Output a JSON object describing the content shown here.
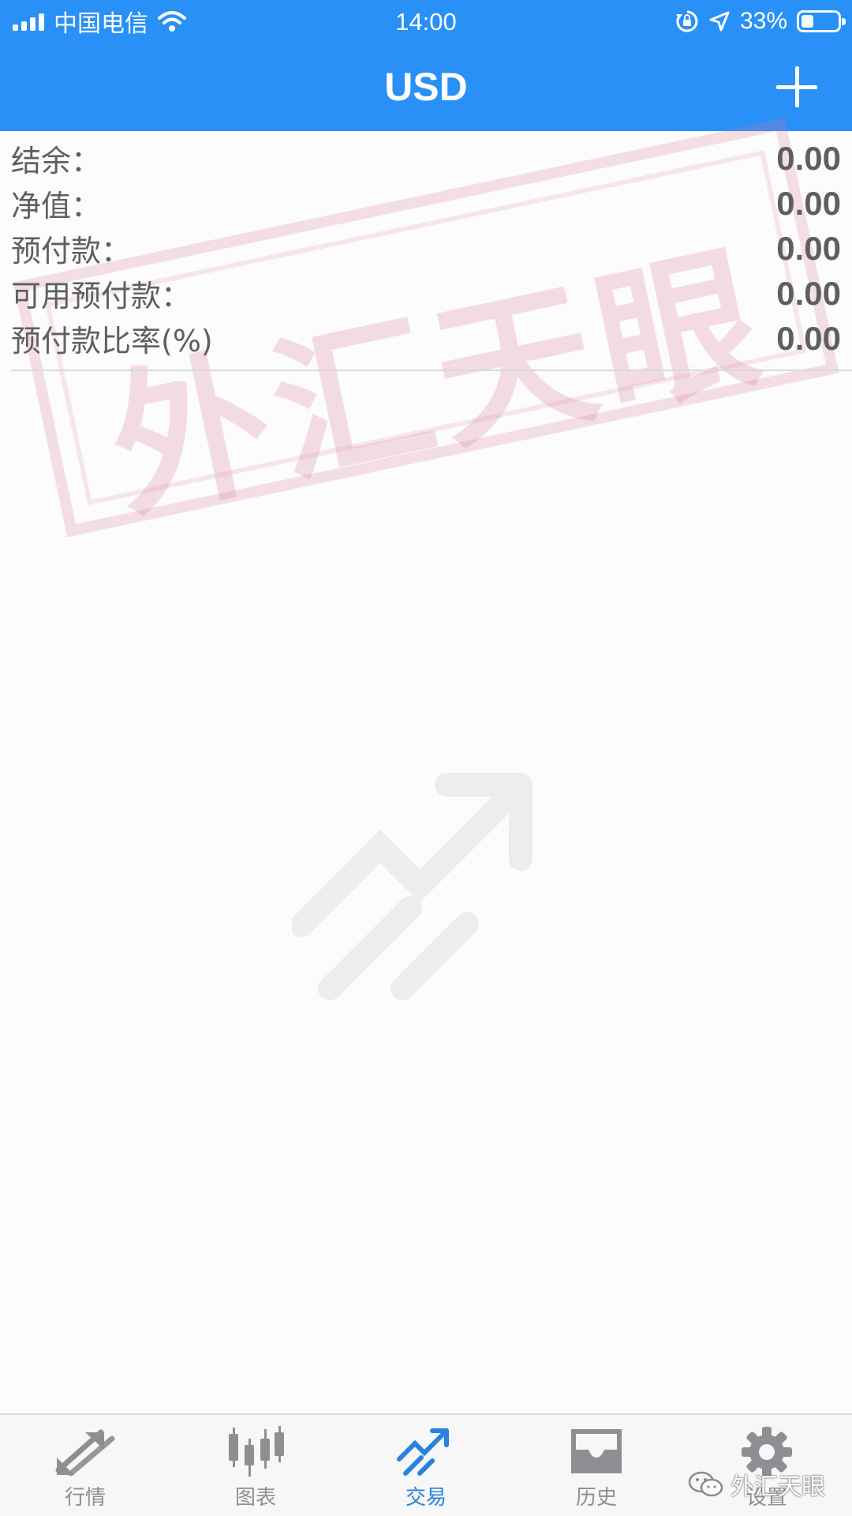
{
  "status_bar": {
    "carrier": "中国电信",
    "time": "14:00",
    "battery": "33%",
    "battery_level": 0.33
  },
  "header": {
    "title": "USD"
  },
  "summary": {
    "rows": [
      {
        "label": "结余：",
        "value": "0.00"
      },
      {
        "label": "净值：",
        "value": "0.00"
      },
      {
        "label": "预付款：",
        "value": "0.00"
      },
      {
        "label": "可用预付款：",
        "value": "0.00"
      },
      {
        "label": "预付款比率(%)",
        "value": "0.00"
      }
    ]
  },
  "watermark": {
    "stamp_text": "外汇天眼",
    "corner_text": "外汇天眼"
  },
  "tabs": [
    {
      "label": "行情",
      "icon": "quotes-arrows-icon",
      "active": false
    },
    {
      "label": "图表",
      "icon": "candlestick-icon",
      "active": false
    },
    {
      "label": "交易",
      "icon": "trade-trend-icon",
      "active": true
    },
    {
      "label": "历史",
      "icon": "history-inbox-icon",
      "active": false
    },
    {
      "label": "设置",
      "icon": "gear-icon",
      "active": false
    }
  ],
  "colors": {
    "brand_blue": "#2990f8",
    "active_tab": "#2a82e0",
    "inactive_tab": "#8e8e93"
  }
}
